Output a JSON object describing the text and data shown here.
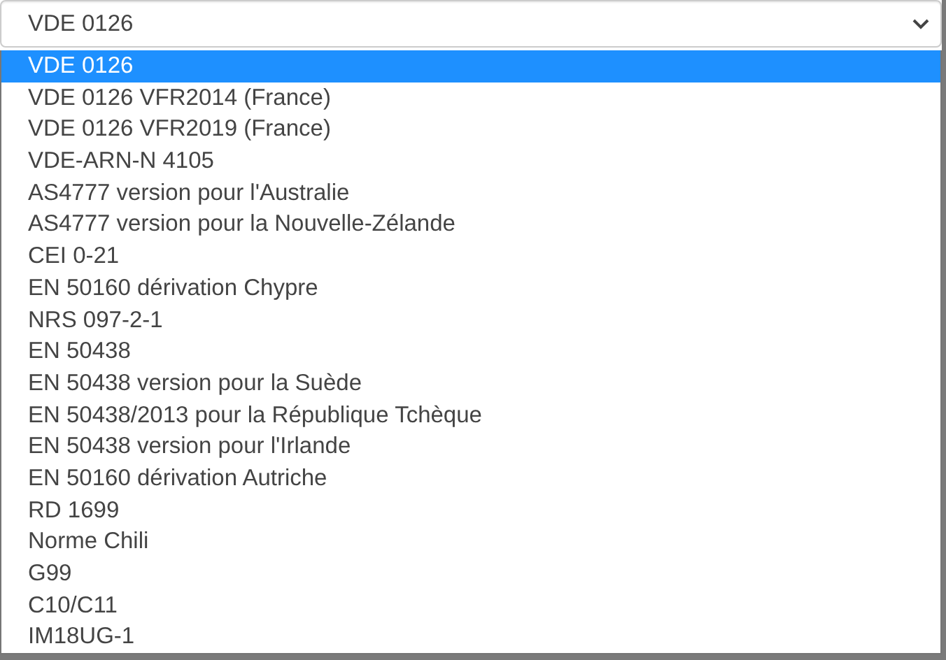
{
  "select": {
    "value": "VDE 0126"
  },
  "options": [
    {
      "label": "VDE 0126",
      "selected": true
    },
    {
      "label": "VDE 0126 VFR2014 (France)",
      "selected": false
    },
    {
      "label": "VDE 0126 VFR2019 (France)",
      "selected": false
    },
    {
      "label": "VDE-ARN-N 4105",
      "selected": false
    },
    {
      "label": "AS4777 version pour l'Australie",
      "selected": false
    },
    {
      "label": "AS4777 version pour la Nouvelle-Zélande",
      "selected": false
    },
    {
      "label": "CEI 0-21",
      "selected": false
    },
    {
      "label": "EN 50160 dérivation Chypre",
      "selected": false
    },
    {
      "label": "NRS 097-2-1",
      "selected": false
    },
    {
      "label": "EN 50438",
      "selected": false
    },
    {
      "label": "EN 50438 version pour la Suède",
      "selected": false
    },
    {
      "label": "EN 50438/2013 pour la République Tchèque",
      "selected": false
    },
    {
      "label": "EN 50438 version pour l'Irlande",
      "selected": false
    },
    {
      "label": "EN 50160 dérivation Autriche",
      "selected": false
    },
    {
      "label": "RD 1699",
      "selected": false
    },
    {
      "label": "Norme Chili",
      "selected": false
    },
    {
      "label": "G99",
      "selected": false
    },
    {
      "label": "C10/C11",
      "selected": false
    },
    {
      "label": "IM18UG-1",
      "selected": false
    }
  ]
}
